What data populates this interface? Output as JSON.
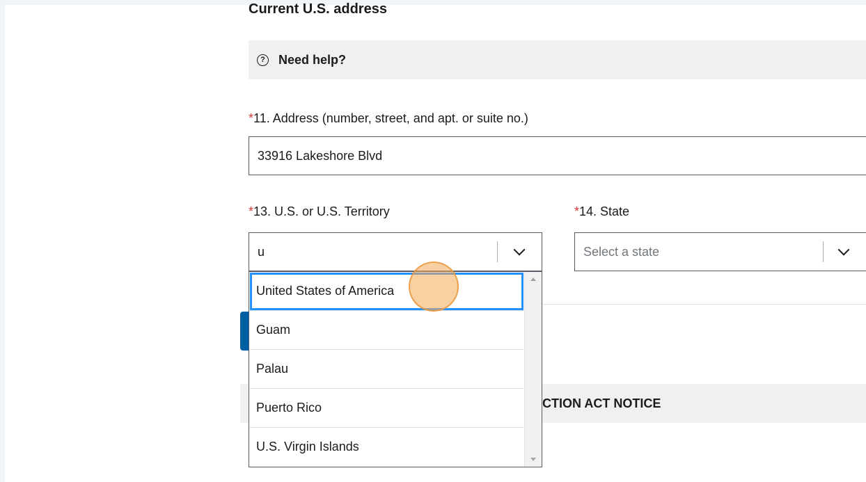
{
  "section": {
    "heading": "Current U.S. address"
  },
  "help": {
    "icon": "question-circle-icon",
    "label": "Need help?"
  },
  "required_marker": "*",
  "address_field": {
    "label": "11. Address (number, street, and apt. or suite no.)",
    "value": "33916 Lakeshore Blvd"
  },
  "territory_field": {
    "label": "13. U.S. or U.S. Territory",
    "value": "u",
    "options": [
      "United States of America",
      "Guam",
      "Palau",
      "Puerto Rico",
      "U.S. Virgin Islands"
    ],
    "focused_option": "United States of America"
  },
  "state_field": {
    "label": "14. State",
    "placeholder": "Select a state"
  },
  "notice": {
    "visible_text": "UCTION ACT NOTICE"
  },
  "colors": {
    "required": "#d83933",
    "focus_outline": "#2491ff",
    "primary_button": "#005ea2",
    "click_marker": "#f3a953"
  }
}
